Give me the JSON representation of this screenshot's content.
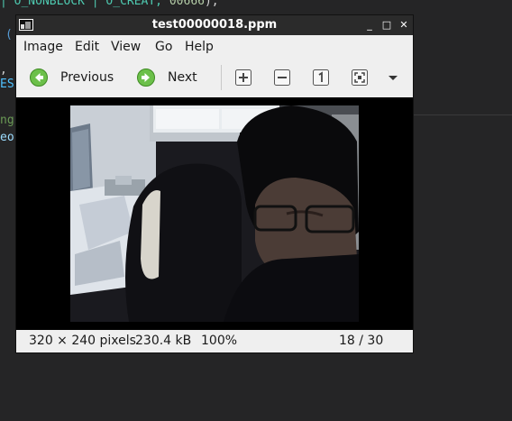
{
  "background_editor": {
    "line1_a": "| O_NONBLOCK | O_CREAT, ",
    "line1_num": "00666",
    "line1_end": ");",
    "paren": "(",
    "comma": ",",
    "es": "ES",
    "ng": "ng",
    "eo": "eo"
  },
  "window": {
    "title": "test00000018.ppm",
    "controls": {
      "minimize": "_",
      "maximize": "□",
      "close": "✕"
    }
  },
  "menu": [
    "Image",
    "Edit",
    "View",
    "Go",
    "Help"
  ],
  "toolbar": {
    "previous_label": "Previous",
    "next_label": "Next",
    "icons": [
      "zoom-in-icon",
      "zoom-out-icon",
      "normal-size-icon",
      "fit-window-icon"
    ]
  },
  "status": {
    "dimensions": "320 × 240 pixels",
    "size": "230.4 kB",
    "zoom": "100%",
    "position": "18 / 30"
  },
  "colors": {
    "title_bar": "#2b2b2b",
    "chrome": "#efefef",
    "nav_green": "#6cc04a"
  }
}
